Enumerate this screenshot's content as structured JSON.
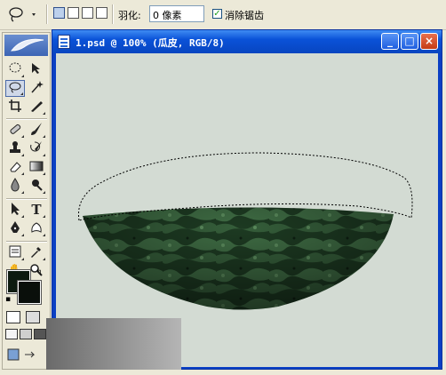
{
  "options_bar": {
    "tool_preset_icon": "lasso-icon",
    "selection_modes": [
      "new-selection-icon",
      "add-to-selection-icon",
      "subtract-from-selection-icon",
      "intersect-selection-icon"
    ],
    "feather_label": "羽化:",
    "feather_value": "0 像素",
    "anti_alias_checked": true,
    "anti_alias_label": "消除锯齿"
  },
  "toolbox": {
    "active_tool": "lasso-icon",
    "foreground_color": "#0c1a10",
    "background_color": "#0a0f0b"
  },
  "document": {
    "title": "1.psd @ 100% (瓜皮, RGB/8)",
    "canvas_color": "#d3dbd3",
    "watermelon_colors": [
      "#1d3a22",
      "#3e6b43",
      "#0e1f12"
    ]
  },
  "window_buttons": {
    "minimize": "_",
    "maximize": "□",
    "close": "×"
  }
}
